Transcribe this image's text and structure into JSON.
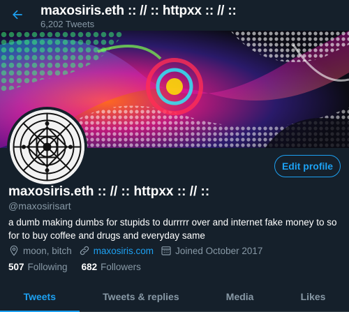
{
  "header": {
    "name": "maxosiris.eth :: // :: httpxx :: // ::",
    "tweet_count": "6,202 Tweets"
  },
  "profile": {
    "display_name": "maxosiris.eth :: // :: httpxx :: // ::",
    "handle": "@maxosirisart",
    "bio": "a dumb making dumbs for stupids to durrrrr over and internet fake money to so for to buy coffee and drugs and everyday same",
    "location": "moon, bitch",
    "website": "maxosiris.com",
    "joined": "Joined October 2017",
    "following_count": "507",
    "following_label": "Following",
    "followers_count": "682",
    "followers_label": "Followers",
    "edit_button": "Edit profile"
  },
  "tabs": [
    {
      "label": "Tweets",
      "active": true
    },
    {
      "label": "Tweets & replies",
      "active": false
    },
    {
      "label": "Media",
      "active": false
    },
    {
      "label": "Likes",
      "active": false
    }
  ],
  "colors": {
    "background": "#15202b",
    "accent": "#1da1f2",
    "muted": "#8899a6"
  },
  "icons": [
    "back-arrow-icon",
    "location-icon",
    "link-icon",
    "calendar-icon"
  ]
}
